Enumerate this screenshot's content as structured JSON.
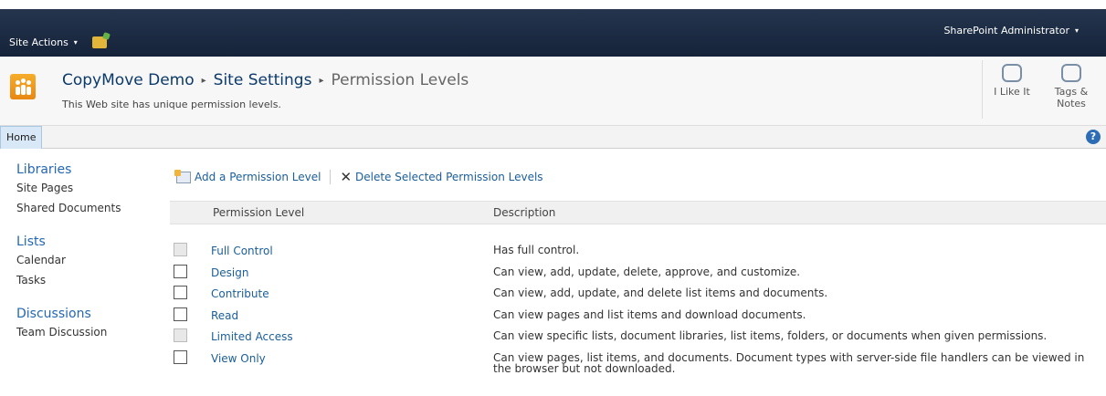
{
  "topbar": {
    "site_actions_label": "Site Actions",
    "site_actions_caret": "▾",
    "user_label": "SharePoint Administrator",
    "user_caret": "▾"
  },
  "title": {
    "breadcrumb": [
      "CopyMove Demo",
      "Site Settings",
      "Permission Levels"
    ],
    "separator": "▸",
    "subtitle": "This Web site has unique permission levels."
  },
  "social": {
    "like_label": "I Like It",
    "tags_label_1": "Tags &",
    "tags_label_2": "Notes"
  },
  "tabs": {
    "home_label": "Home",
    "help_glyph": "?"
  },
  "leftnav": {
    "libraries_heading": "Libraries",
    "libraries_items": [
      "Site Pages",
      "Shared Documents"
    ],
    "lists_heading": "Lists",
    "lists_items": [
      "Calendar",
      "Tasks"
    ],
    "discussions_heading": "Discussions",
    "discussions_items": [
      "Team Discussion"
    ]
  },
  "toolbar": {
    "add_label": "Add a Permission Level",
    "delete_label": "Delete Selected Permission Levels",
    "delete_glyph": "✕"
  },
  "table": {
    "col_level": "Permission Level",
    "col_description": "Description",
    "rows": [
      {
        "level": "Full Control",
        "description": "Has full control.",
        "disabled": true
      },
      {
        "level": "Design",
        "description": "Can view, add, update, delete, approve, and customize.",
        "disabled": false
      },
      {
        "level": "Contribute",
        "description": "Can view, add, update, and delete list items and documents.",
        "disabled": false
      },
      {
        "level": "Read",
        "description": "Can view pages and list items and download documents.",
        "disabled": false
      },
      {
        "level": "Limited Access",
        "description": "Can view specific lists, document libraries, list items, folders, or documents when given permissions.",
        "disabled": true
      },
      {
        "level": "View Only",
        "description": "Can view pages, list items, and documents. Document types with server-side file handlers can be viewed in the browser but not downloaded.",
        "disabled": false
      }
    ]
  },
  "colors": {
    "topbar": "#1e2e44",
    "link": "#1a5e9a",
    "nav_heading": "#2368b5",
    "logo": "#f39c12"
  }
}
